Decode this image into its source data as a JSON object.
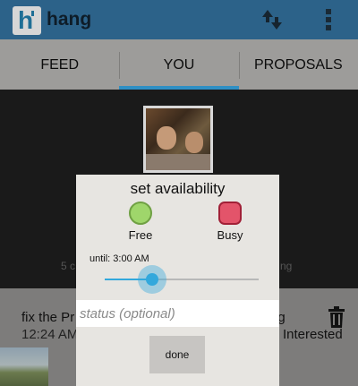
{
  "app": {
    "logo_letter": "h",
    "title": "hang"
  },
  "actionbar": {
    "sync_icon": "sync-arrows-icon",
    "overflow_icon": "overflow-menu-icon"
  },
  "tabs": [
    {
      "label": "FEED",
      "active": false
    },
    {
      "label": "YOU",
      "active": true
    },
    {
      "label": "PROPOSALS",
      "active": false
    }
  ],
  "background": {
    "count_text_left": "5 c",
    "count_text_right": "ng",
    "feed_item": {
      "title": "fix the Pr",
      "time": "12:24 AM",
      "tag": "og",
      "status": "Interested",
      "delete_icon": "trash-icon"
    }
  },
  "dialog": {
    "title": "set availability",
    "options": [
      {
        "label": "Free",
        "color": "#9fd66b"
      },
      {
        "label": "Busy",
        "color": "#e3546a"
      }
    ],
    "until_label": "until: 3:00 AM",
    "slider_fraction": 0.31,
    "status_value": "",
    "status_placeholder": "status (optional)",
    "done_label": "done"
  },
  "colors": {
    "actionbar": "#2c6289",
    "accent": "#2f8fc4"
  }
}
